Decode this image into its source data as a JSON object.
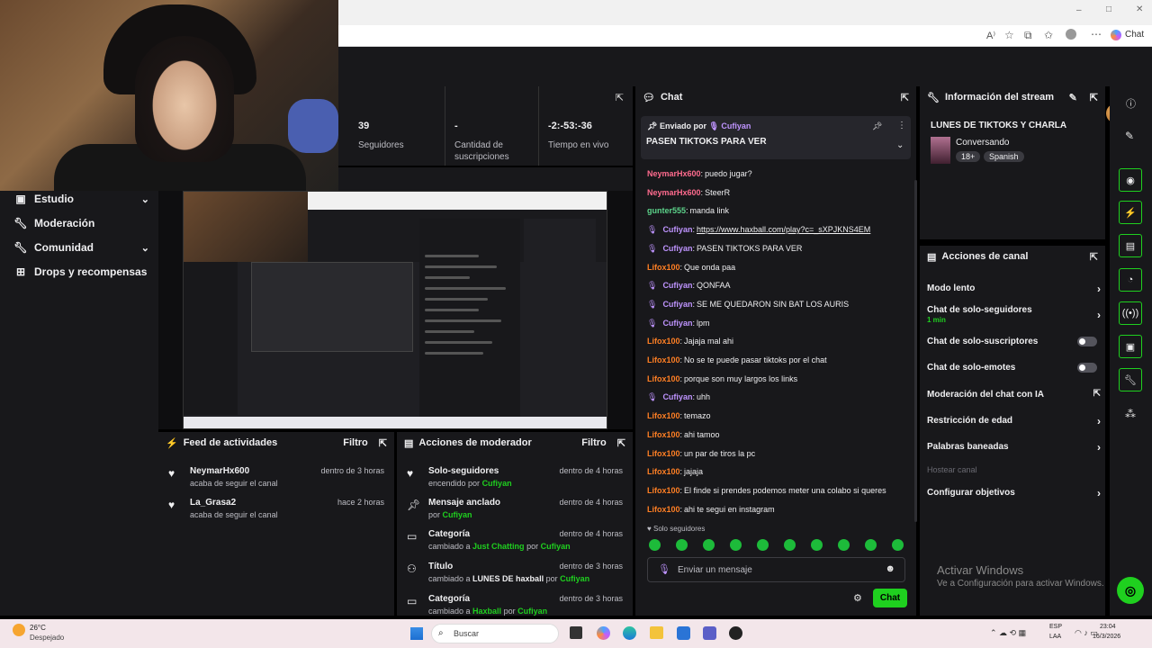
{
  "browser": {
    "window_controls": [
      "–",
      "□",
      "✕"
    ],
    "profile_label": "Chat"
  },
  "stats": [
    {
      "value": "39",
      "label": "Seguidores"
    },
    {
      "value": "-",
      "label": "Cantidad de suscripciones"
    },
    {
      "value": "-2:-53:-36",
      "label": "Tiempo en vivo"
    }
  ],
  "sidebar": {
    "items": [
      {
        "label": "Estudio",
        "icon": "studio-icon",
        "has_chevron": true
      },
      {
        "label": "Moderación",
        "icon": "wrench-icon",
        "has_chevron": false
      },
      {
        "label": "Comunidad",
        "icon": "wrench-icon",
        "has_chevron": true
      },
      {
        "label": "Drops y recompensas",
        "icon": "gift-icon",
        "has_chevron": false
      }
    ]
  },
  "chat": {
    "title": "Chat",
    "pinned": {
      "sent_by": "Enviado por",
      "user": "Cufiyan",
      "text": "PASEN TIKTOKS PARA VER"
    },
    "messages": [
      {
        "user": "NeymarHx600",
        "text": "puedo jugar?",
        "color": "pink",
        "badge": false
      },
      {
        "user": "NeymarHx600",
        "text": "SteerR",
        "color": "pink",
        "badge": false
      },
      {
        "user": "gunter555",
        "text": "manda link",
        "color": "teal",
        "badge": false
      },
      {
        "user": "Cufiyan",
        "text": "",
        "link": "https://www.haxball.com/play?c=_sXPJKNS4EM",
        "color": "purple",
        "badge": true
      },
      {
        "user": "Cufiyan",
        "text": "PASEN TIKTOKS PARA VER",
        "color": "purple",
        "badge": true
      },
      {
        "user": "Lifox100",
        "text": "Que onda paa",
        "color": "orange",
        "badge": false
      },
      {
        "user": "Cufiyan",
        "text": "QONFAA",
        "color": "purple",
        "badge": true
      },
      {
        "user": "Cufiyan",
        "text": "SE ME QUEDARON SIN BAT LOS AURIS",
        "color": "purple",
        "badge": true
      },
      {
        "user": "Cufiyan",
        "text": "lpm",
        "color": "purple",
        "badge": true
      },
      {
        "user": "Lifox100",
        "text": "Jajaja mal ahi",
        "color": "orange",
        "badge": false
      },
      {
        "user": "Lifox100",
        "text": "No se te puede pasar tiktoks por el chat",
        "color": "orange",
        "badge": false
      },
      {
        "user": "Lifox100",
        "text": "porque son muy largos los links",
        "color": "orange",
        "badge": false
      },
      {
        "user": "Cufiyan",
        "text": "uhh",
        "color": "purple",
        "badge": true
      },
      {
        "user": "Lifox100",
        "text": "temazo",
        "color": "orange",
        "badge": false
      },
      {
        "user": "Lifox100",
        "text": "ahi tamoo",
        "color": "orange",
        "badge": false
      },
      {
        "user": "Lifox100",
        "text": "un par de tiros la pc",
        "color": "orange",
        "badge": false
      },
      {
        "user": "Lifox100",
        "text": "jajaja",
        "color": "orange",
        "badge": false
      },
      {
        "user": "Lifox100",
        "text": "El finde si prendes podemos meter una colabo si queres",
        "color": "orange",
        "badge": false
      },
      {
        "user": "Lifox100",
        "text": "ahi te segui en instagram",
        "color": "orange",
        "badge": false
      }
    ],
    "mode_label": "Solo seguidores",
    "input_placeholder": "Enviar un mensaje",
    "send_label": "Chat"
  },
  "stream_info": {
    "title": "Información del stream",
    "stream_title": "LUNES DE TIKTOKS Y CHARLA",
    "category": "Conversando",
    "tags": [
      "18+",
      "Spanish"
    ]
  },
  "channel_actions": {
    "title": "Acciones de canal",
    "items": [
      {
        "label": "Modo lento",
        "control": "chevron"
      },
      {
        "label": "Chat de solo-seguidores",
        "sub": "1 min",
        "control": "chevron"
      },
      {
        "label": "Chat de solo-suscriptores",
        "control": "toggle"
      },
      {
        "label": "Chat de solo-emotes",
        "control": "toggle"
      },
      {
        "label": "Moderación del chat con IA",
        "control": "external"
      },
      {
        "label": "Restricción de edad",
        "control": "chevron"
      },
      {
        "label": "Palabras baneadas",
        "control": "chevron"
      },
      {
        "label": "Hostear canal",
        "control": "disabled"
      },
      {
        "label": "Configurar objetivos",
        "control": "chevron"
      }
    ]
  },
  "activity_feed": {
    "title": "Feed de actividades",
    "filter": "Filtro",
    "items": [
      {
        "name": "NeymarHx600",
        "sub": "acaba de seguir el canal",
        "time": "dentro de 3 horas"
      },
      {
        "name": "La_Grasa2",
        "sub": "acaba de seguir el canal",
        "time": "hace 2 horas"
      }
    ]
  },
  "mod_actions": {
    "title": "Acciones de moderador",
    "filter": "Filtro",
    "items": [
      {
        "name": "Solo-seguidores",
        "sub_pre": "encendido por",
        "sub_mid": "",
        "sub_user": "Cufiyan",
        "time": "dentro de 4 horas",
        "icon": "heart-icon"
      },
      {
        "name": "Mensaje anclado",
        "sub_pre": "por",
        "sub_mid": "",
        "sub_user": "Cufiyan",
        "time": "dentro de 4 horas",
        "icon": "pin-icon"
      },
      {
        "name": "Categoría",
        "sub_pre": "cambiado a",
        "sub_mid": "Just Chatting",
        "sub_user": "Cufiyan",
        "time": "dentro de 4 horas",
        "icon": "category-icon"
      },
      {
        "name": "Título",
        "sub_pre": "cambiado a",
        "sub_mid": "LUNES DE haxball",
        "sub_user": "Cufiyan",
        "time": "dentro de 3 horas",
        "icon": "title-icon"
      },
      {
        "name": "Categoría",
        "sub_pre": "cambiado a",
        "sub_mid": "Haxball",
        "sub_user": "Cufiyan",
        "time": "dentro de 3 horas",
        "icon": "category-icon"
      }
    ],
    "by": "por"
  },
  "watermark": {
    "line1": "Activar Windows",
    "line2": "Ve a Configuración para activar Windows."
  },
  "taskbar": {
    "weather_temp": "26°C",
    "weather_desc": "Despejado",
    "search_placeholder": "Buscar",
    "lang1": "ESP",
    "lang2": "LAA",
    "time": "23:04",
    "date": "16/3/2026"
  },
  "colors": {
    "accent": "#1fd01f",
    "panel": "#18181b",
    "bg": "#000000"
  }
}
